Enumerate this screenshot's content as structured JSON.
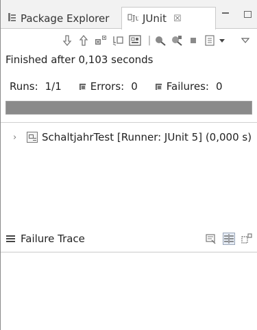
{
  "tabs": {
    "package_explorer": {
      "label": "Package Explorer",
      "icon": "package-explorer-icon"
    },
    "junit": {
      "label": "JUnit",
      "icon": "junit-icon",
      "close": "☒"
    }
  },
  "toolbar": {
    "icons": [
      "next-failure-icon",
      "previous-failure-icon",
      "show-failures-only-icon",
      "scroll-lock-icon",
      "show-skipped-icon",
      "rerun-icon",
      "rerun-failed-first-icon",
      "stop-icon",
      "test-run-history-icon",
      "history-dropdown-icon",
      "view-menu-icon"
    ]
  },
  "status": {
    "text": "Finished after 0,103 seconds"
  },
  "counters": {
    "runs_label": "Runs:",
    "runs_value": "1/1",
    "errors_label": "Errors:",
    "errors_value": "0",
    "failures_label": "Failures:",
    "failures_value": "0"
  },
  "progress": {
    "fraction": 1.0,
    "color": "#8a8a8a"
  },
  "tree": {
    "items": [
      {
        "label": "SchaltjahrTest [Runner: JUnit 5] (0,000 s)",
        "icon": "test-suite-icon",
        "expanded": false
      }
    ]
  },
  "failure_trace": {
    "title": "Failure Trace",
    "tools": [
      "filter-stack-trace-icon",
      "compare-results-icon",
      "copy-trace-icon"
    ]
  }
}
